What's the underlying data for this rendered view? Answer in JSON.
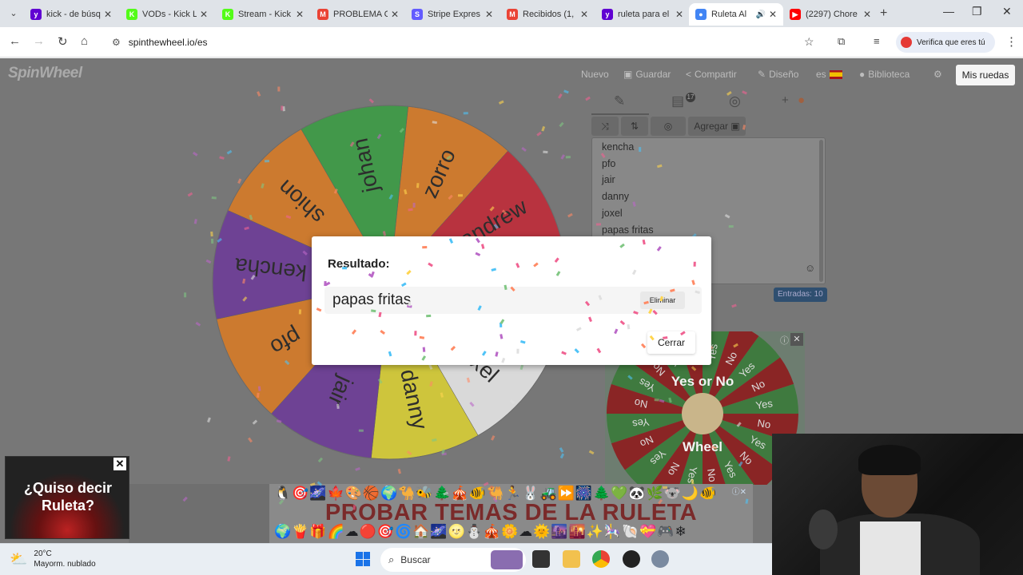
{
  "browser": {
    "tabs": [
      {
        "title": "kick - de búsq",
        "color": "#6001d2",
        "glyph": "y"
      },
      {
        "title": "VODs - Kick L",
        "color": "#53fc18",
        "glyph": "K"
      },
      {
        "title": "Stream - Kick",
        "color": "#53fc18",
        "glyph": "K"
      },
      {
        "title": "PROBLEMA C",
        "color": "#ea4335",
        "glyph": "M"
      },
      {
        "title": "Stripe Expres",
        "color": "#635bff",
        "glyph": "S"
      },
      {
        "title": "Recibidos (1,",
        "color": "#ea4335",
        "glyph": "M"
      },
      {
        "title": "ruleta para el",
        "color": "#6001d2",
        "glyph": "y"
      },
      {
        "title": "Ruleta Al",
        "color": "#4285f4",
        "glyph": "●"
      },
      {
        "title": "(2297) Chore",
        "color": "#ff0000",
        "glyph": "▶"
      }
    ],
    "url": "spinthewheel.io/es",
    "verify_label": "Verifica que eres tú"
  },
  "site": {
    "logo": "SpinWheel",
    "menu": {
      "nuevo": "Nuevo",
      "guardar": "Guardar",
      "compartir": "Compartir",
      "diseno": "Diseño",
      "lang": "es",
      "biblioteca": "Biblioteca",
      "mis_ruedas": "Mis ruedas"
    },
    "editor": {
      "badge": "17",
      "agregar": "Agregar",
      "entries": [
        "kencha",
        "pfo",
        "jair",
        "danny",
        "joxel",
        "papas fritas"
      ],
      "count_label": "Entradas: 10"
    },
    "wheel": {
      "segments": [
        {
          "label": "zorro",
          "color": "#ee7c14"
        },
        {
          "label": "andrew",
          "color": "#d11a2a"
        },
        {
          "label": "",
          "color": "#2d79c7"
        },
        {
          "label": "joxel",
          "color": "#ffffff"
        },
        {
          "label": "danny",
          "color": "#f0e326"
        },
        {
          "label": "jair",
          "color": "#6b2ea0"
        },
        {
          "label": "pfo",
          "color": "#ee7c14"
        },
        {
          "label": "kencha",
          "color": "#6b2ea0"
        },
        {
          "label": "shion",
          "color": "#ee7c14"
        },
        {
          "label": "johan",
          "color": "#2fa53a"
        }
      ]
    },
    "ads": {
      "yes_no": {
        "title": "Yes or No",
        "subtitle": "Wheel",
        "yes": "Yes",
        "no": "No"
      },
      "banner_title": "PROBAR TEMAS DE LA RULETA",
      "roulette": "¿Quiso decir Ruleta?"
    }
  },
  "dialog": {
    "title": "Resultado:",
    "result": "papas fritas",
    "delete_label": "Eliminar",
    "close_label": "Cerrar"
  },
  "taskbar": {
    "temp": "20°C",
    "weather": "Mayorm. nublado",
    "search_placeholder": "Buscar"
  }
}
